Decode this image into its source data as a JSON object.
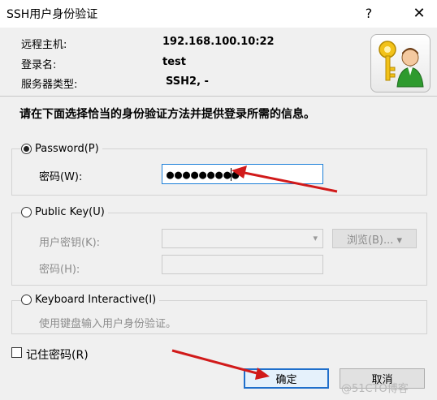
{
  "window": {
    "title": "SSH用户身份验证",
    "help_glyph": "?",
    "close_glyph": "✕"
  },
  "info": {
    "host_label": "远程主机:",
    "host_value": "192.168.100.10:22",
    "login_label": "登录名:",
    "login_value": "test",
    "server_type_label": "服务器类型:",
    "server_type_value": "SSH2, -"
  },
  "instruction": "请在下面选择恰当的身份验证方法并提供登录所需的信息。",
  "password_group": {
    "radio_label": "Password(P)",
    "selected": true,
    "field_label": "密码(W):",
    "field_value": "●●●●●●●●●"
  },
  "pubkey_group": {
    "radio_label": "Public Key(U)",
    "selected": false,
    "key_label": "用户密钥(K):",
    "key_value": "",
    "browse_label": "浏览(B)... ▾",
    "pass_label": "密码(H):",
    "pass_value": ""
  },
  "kbd_group": {
    "radio_label": "Keyboard Interactive(I)",
    "selected": false,
    "description": "使用键盘输入用户身份验证。"
  },
  "remember": {
    "label": "记住密码(R)",
    "checked": false
  },
  "buttons": {
    "ok": "确定",
    "cancel": "取消"
  },
  "watermark": "@51CTO博客",
  "colors": {
    "focus_border": "#1c7fd8",
    "default_button_border": "#1f6fcb",
    "annotation_arrow": "#d11a1a"
  },
  "icons": {
    "logo": "keys-user-icon"
  }
}
